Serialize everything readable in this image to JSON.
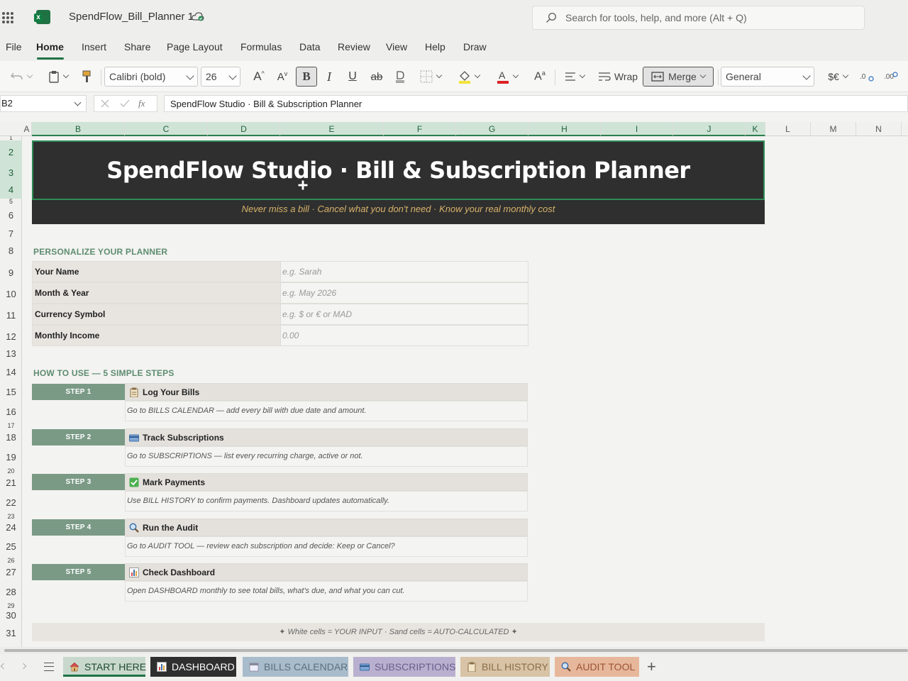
{
  "app": {
    "doc_title": "SpendFlow_Bill_Planner 1",
    "search_placeholder": "Search for tools, help, and more (Alt + Q)"
  },
  "menu": [
    "File",
    "Home",
    "Insert",
    "Share",
    "Page Layout",
    "Formulas",
    "Data",
    "Review",
    "View",
    "Help",
    "Draw"
  ],
  "active_menu": "Home",
  "ribbon": {
    "font_name": "Calibri (bold)",
    "font_size": "26",
    "bold": "B",
    "italic": "I",
    "underline": "U",
    "strike": "ab",
    "wrap_label": "Wrap",
    "merge_label": "Merge",
    "number_format": "General",
    "currency": "$€"
  },
  "formula_bar": {
    "cell_ref": "B2",
    "fx": "fx",
    "content": "SpendFlow Studio · Bill & Subscription Planner"
  },
  "columns": [
    "A",
    "B",
    "C",
    "D",
    "E",
    "F",
    "G",
    "H",
    "I",
    "J",
    "K",
    "L",
    "M",
    "N"
  ],
  "rows": [
    "1",
    "2",
    "3",
    "4",
    "5",
    "6",
    "7",
    "8",
    "9",
    "10",
    "11",
    "12",
    "13",
    "14",
    "15",
    "16",
    "17",
    "18",
    "19",
    "20",
    "21",
    "22",
    "23",
    "24",
    "25",
    "26",
    "27",
    "28",
    "29",
    "30",
    "31"
  ],
  "sheet": {
    "title": "SpendFlow Studio  ·  Bill & Subscription Planner",
    "tagline": "Never miss a bill  ·  Cancel what you don't need  ·  Know your real monthly cost",
    "personalize_heading": "PERSONALIZE YOUR PLANNER",
    "personalize": [
      {
        "label": "Your Name",
        "placeholder": "e.g. Sarah"
      },
      {
        "label": "Month & Year",
        "placeholder": "e.g. May 2026"
      },
      {
        "label": "Currency Symbol",
        "placeholder": "e.g. $ or € or MAD"
      },
      {
        "label": "Monthly Income",
        "placeholder": "0.00"
      }
    ],
    "steps_heading": "HOW TO USE — 5 SIMPLE STEPS",
    "steps": [
      {
        "badge": "STEP 1",
        "icon": "clipboard-icon",
        "title": "Log Your Bills",
        "desc": "Go to BILLS CALENDAR — add every bill with due date and amount."
      },
      {
        "badge": "STEP 2",
        "icon": "credit-card-icon",
        "title": "Track Subscriptions",
        "desc": "Go to SUBSCRIPTIONS — list every recurring charge, active or not."
      },
      {
        "badge": "STEP 3",
        "icon": "check-box-icon",
        "title": "Mark Payments",
        "desc": "Use BILL HISTORY to confirm payments. Dashboard updates automatically."
      },
      {
        "badge": "STEP 4",
        "icon": "magnifier-icon",
        "title": "Run the Audit",
        "desc": "Go to AUDIT TOOL — review each subscription and decide: Keep or Cancel?"
      },
      {
        "badge": "STEP 5",
        "icon": "bar-chart-icon",
        "title": "Check Dashboard",
        "desc": "Open DASHBOARD monthly to see total bills, what's due, and what you can cut."
      }
    ],
    "legend": "✦  White cells = YOUR INPUT    ·    Sand cells = AUTO-CALCULATED  ✦"
  },
  "tabs": [
    {
      "label": "START HERE",
      "icon": "house-icon",
      "bg": "#c9d8cd",
      "color": "#1f4a30"
    },
    {
      "label": "DASHBOARD",
      "icon": "bar-chart-icon",
      "bg": "#2f2f2f",
      "color": "#ffffff"
    },
    {
      "label": "BILLS CALENDAR",
      "icon": "calendar-icon",
      "bg": "#a9bccc",
      "color": "#5c6f80"
    },
    {
      "label": "SUBSCRIPTIONS",
      "icon": "credit-card-icon",
      "bg": "#b9b0cf",
      "color": "#6b5d8c"
    },
    {
      "label": "BILL HISTORY",
      "icon": "clipboard-icon",
      "bg": "#d8c3a6",
      "color": "#8a6e48"
    },
    {
      "label": "AUDIT TOOL",
      "icon": "magnifier-icon",
      "bg": "#e7b79b",
      "color": "#9a5535"
    }
  ],
  "colors": {
    "accent": "#1f7244",
    "banner_bg": "#2f2f2f",
    "tagline": "#d8b36a",
    "section_heading": "#5e8c70",
    "step_badge": "#7a9a86"
  }
}
